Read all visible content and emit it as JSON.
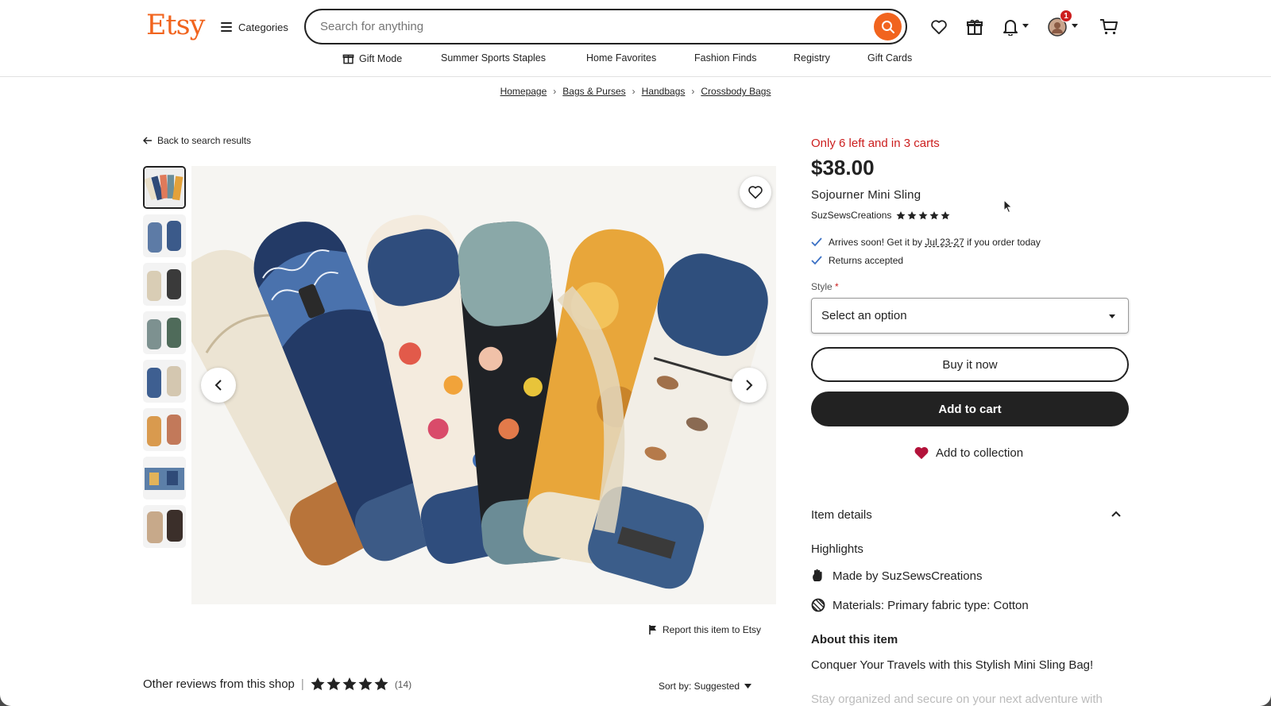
{
  "header": {
    "logo": "Etsy",
    "categories_label": "Categories",
    "search_placeholder": "Search for anything",
    "notification_count": "1"
  },
  "subnav": [
    "Gift Mode",
    "Summer Sports Staples",
    "Home Favorites",
    "Fashion Finds",
    "Registry",
    "Gift Cards"
  ],
  "breadcrumb": [
    "Homepage",
    "Bags & Purses",
    "Handbags",
    "Crossbody Bags"
  ],
  "back_link": "Back to search results",
  "report_link": "Report this item to Etsy",
  "reviews": {
    "heading": "Other reviews from this shop",
    "count": "(14)",
    "sort": "Sort by: Suggested"
  },
  "listing": {
    "stock_note": "Only 6 left and in 3 carts",
    "price": "$38.00",
    "title": "Sojourner Mini Sling",
    "shop_name": "SuzSewsCreations",
    "rating_stars": 5,
    "arrives_prefix": "Arrives soon! Get it by",
    "arrives_dates": "Jul 23-27",
    "arrives_suffix": "if you order today",
    "returns": "Returns accepted",
    "style_label": "Style",
    "style_required_mark": "*",
    "style_select": "Select an option",
    "buy_now": "Buy it now",
    "add_to_cart": "Add to cart",
    "add_to_collection": "Add to collection"
  },
  "details": {
    "heading": "Item details",
    "highlights_heading": "Highlights",
    "made_by_prefix": "Made by",
    "made_by_shop": "SuzSewsCreations",
    "materials": "Materials: Primary fabric type: Cotton",
    "about_heading": "About this item",
    "about_text": "Conquer Your Travels with this Stylish Mini Sling Bag!",
    "about_next": "Stay organized and secure on your next adventure with"
  },
  "colors": {
    "brand": "#F1641E",
    "alert": "#CC1F1F",
    "dark": "#222222"
  }
}
